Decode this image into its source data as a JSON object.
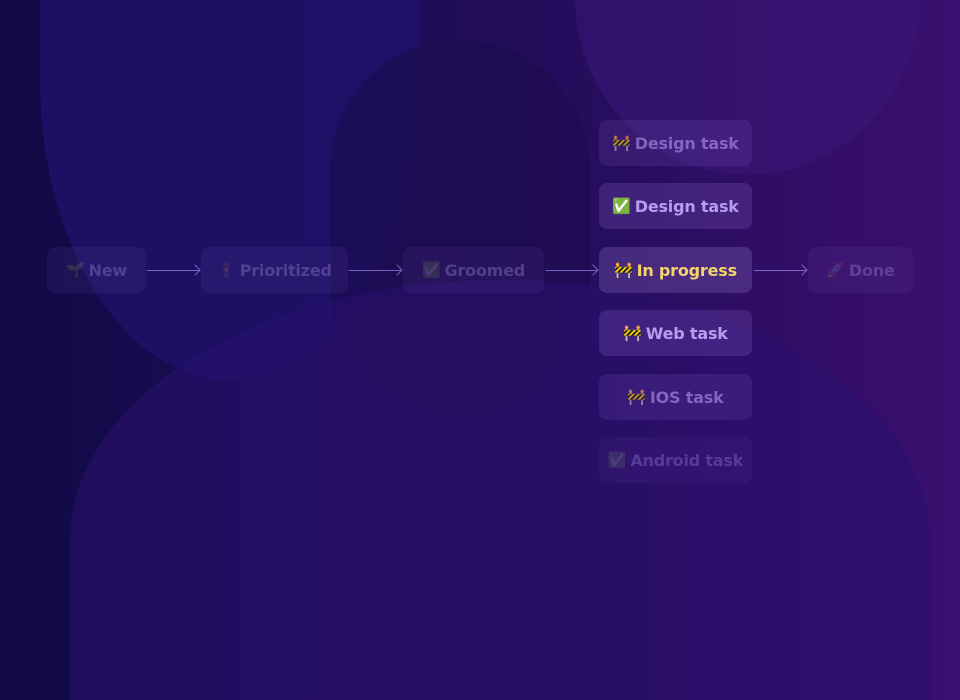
{
  "pipeline": {
    "stages": [
      {
        "icon": "🌱",
        "icon_name": "seedling-icon",
        "label": "New"
      },
      {
        "icon": "🚦",
        "icon_name": "traffic-light-icon",
        "label": "Prioritized"
      },
      {
        "icon": "✅",
        "icon_name": "check-box-icon",
        "label": "Groomed"
      },
      {
        "icon": "🚧",
        "icon_name": "construction-icon",
        "label": "In progress"
      },
      {
        "icon": "🚀",
        "icon_name": "rocket-icon",
        "label": "Done"
      }
    ],
    "active_stage": "In progress"
  },
  "subtasks": [
    {
      "icon": "🚧",
      "icon_name": "construction-icon",
      "label": "Design task",
      "status": "in-progress"
    },
    {
      "icon": "✅",
      "icon_name": "check-box-icon",
      "label": "Design task",
      "status": "done"
    },
    {
      "icon": "🚧",
      "icon_name": "construction-icon",
      "label": "Web task",
      "status": "in-progress"
    },
    {
      "icon": "🚧",
      "icon_name": "construction-icon",
      "label": "IOS task",
      "status": "in-progress"
    },
    {
      "icon": "✅",
      "icon_name": "check-box-icon",
      "label": "Android task",
      "status": "done"
    }
  ],
  "colors": {
    "active_text": "#f4d36a",
    "task_text": "#b89cf0",
    "arrow": "#7a64c4"
  }
}
